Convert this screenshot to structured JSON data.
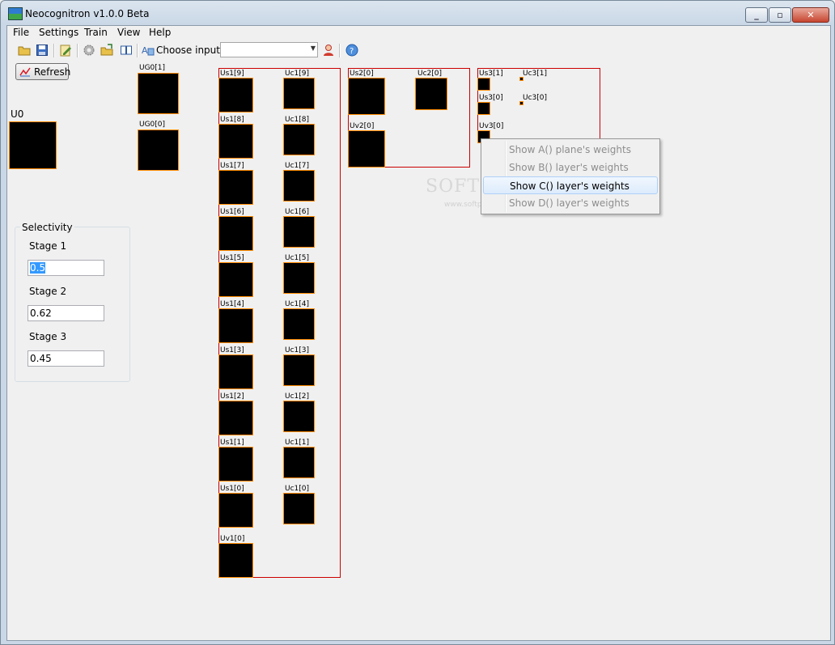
{
  "window": {
    "title": "Neocognitron v1.0.0 Beta"
  },
  "menu": [
    "File",
    "Settings",
    "Train",
    "View",
    "Help"
  ],
  "toolbar": {
    "choose_label": "Choose input:",
    "choose_value": ""
  },
  "refresh_label": "Refresh",
  "labels": {
    "u0": "U0",
    "ug0_1": "UG0[1]",
    "ug0_0": "UG0[0]",
    "us1": [
      "Us1[9]",
      "Us1[8]",
      "Us1[7]",
      "Us1[6]",
      "Us1[5]",
      "Us1[4]",
      "Us1[3]",
      "Us1[2]",
      "Us1[1]",
      "Us1[0]"
    ],
    "uc1": [
      "Uc1[9]",
      "Uc1[8]",
      "Uc1[7]",
      "Uc1[6]",
      "Uc1[5]",
      "Uc1[4]",
      "Uc1[3]",
      "Uc1[2]",
      "Uc1[1]",
      "Uc1[0]"
    ],
    "uv1": "Uv1[0]",
    "us2": "Us2[0]",
    "uc2": "Uc2[0]",
    "uv2": "Uv2[0]",
    "us3_1": "Us3[1]",
    "uc3_1": "Uc3[1]",
    "us3_0": "Us3[0]",
    "uc3_0": "Uc3[0]",
    "uv3": "Uv3[0]"
  },
  "selectivity": {
    "title": "Selectivity",
    "stages": [
      {
        "label": "Stage 1",
        "value": "0.5"
      },
      {
        "label": "Stage 2",
        "value": "0.62"
      },
      {
        "label": "Stage 3",
        "value": "0.45"
      }
    ]
  },
  "context_menu": [
    {
      "label": "Show A() plane's weights",
      "enabled": false
    },
    {
      "label": "Show B() layer's weights",
      "enabled": false
    },
    {
      "label": "Show C() layer's weights",
      "enabled": true,
      "highlighted": true
    },
    {
      "label": "Show D() layer's weights",
      "enabled": false
    }
  ],
  "watermark": {
    "main": "SOFTPEDIA",
    "sub": "www.softpedia.com"
  },
  "colors": {
    "cell_border": "#ff8c00",
    "frame": "#cc0000",
    "highlight": "#dcebfc"
  }
}
